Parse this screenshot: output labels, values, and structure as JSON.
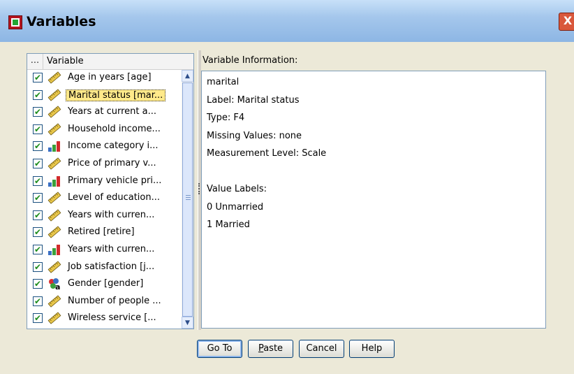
{
  "window": {
    "title": "Variables",
    "close_symbol": "X"
  },
  "list": {
    "header_col1": "...",
    "header_col2": "Variable",
    "items": [
      {
        "label": "Age in years [age]",
        "icon": "scale-ruler-icon",
        "checked": true
      },
      {
        "label": "Marital status [mar...",
        "icon": "scale-ruler-icon",
        "checked": true,
        "selected": true
      },
      {
        "label": "Years at current a...",
        "icon": "scale-ruler-icon",
        "checked": true
      },
      {
        "label": "Household income...",
        "icon": "scale-ruler-icon",
        "checked": true
      },
      {
        "label": "Income category i...",
        "icon": "ordinal-bars-icon",
        "checked": true
      },
      {
        "label": "Price of primary v...",
        "icon": "scale-ruler-icon",
        "checked": true
      },
      {
        "label": "Primary vehicle pri...",
        "icon": "ordinal-bars-icon",
        "checked": true
      },
      {
        "label": "Level of education...",
        "icon": "scale-ruler-icon",
        "checked": true
      },
      {
        "label": "Years with curren...",
        "icon": "scale-ruler-icon",
        "checked": true
      },
      {
        "label": "Retired [retire]",
        "icon": "scale-ruler-icon",
        "checked": true
      },
      {
        "label": "Years with curren...",
        "icon": "ordinal-bars-icon",
        "checked": true
      },
      {
        "label": "Job satisfaction [j...",
        "icon": "scale-ruler-icon",
        "checked": true
      },
      {
        "label": "Gender [gender]",
        "icon": "nominal-string-icon",
        "checked": true
      },
      {
        "label": "Number of people ...",
        "icon": "scale-ruler-icon",
        "checked": true
      },
      {
        "label": "Wireless service [...",
        "icon": "scale-ruler-icon",
        "checked": true
      }
    ]
  },
  "info": {
    "label": "Variable Information:",
    "lines": [
      "marital",
      "Label:  Marital status",
      "Type:  F4",
      "Missing Values:  none",
      "Measurement Level:  Scale",
      "",
      "Value Labels:",
      "0   Unmarried",
      "1   Married"
    ]
  },
  "buttons": {
    "goto": "Go To",
    "paste_u": "P",
    "paste_rest": "aste",
    "cancel": "Cancel",
    "help": "Help"
  },
  "colors": {
    "accent": "#7f9db9",
    "selection": "#ffe98a"
  }
}
